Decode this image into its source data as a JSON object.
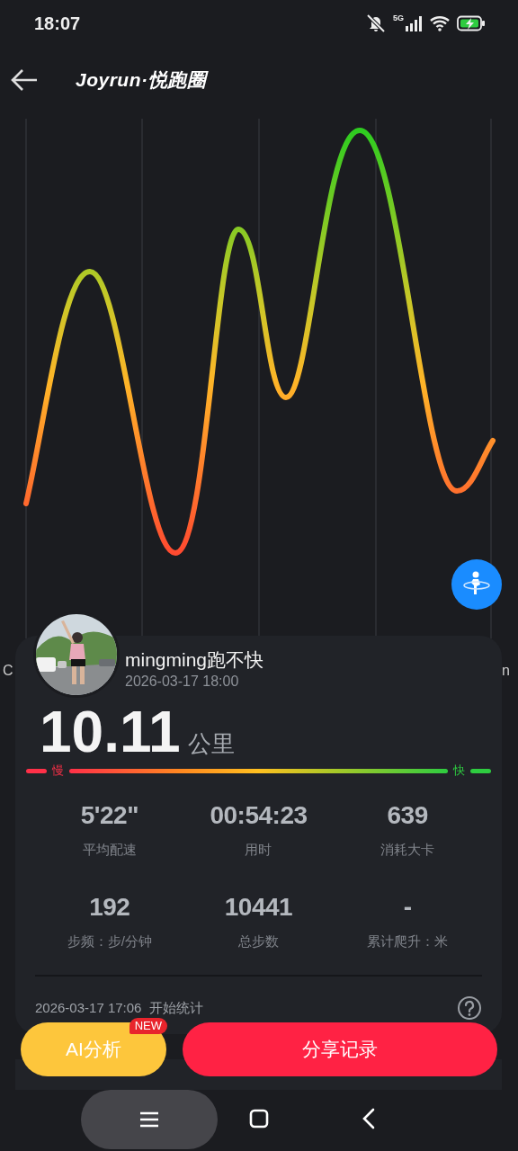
{
  "status_bar": {
    "time": "18:07",
    "network": "5G"
  },
  "header": {
    "title": "Joyrun·悦跑圈"
  },
  "chart": {
    "edge_label_left": "C",
    "edge_label_right": "n"
  },
  "run": {
    "user_name": "mingming跑不快",
    "date": "2026-03-17 18:00",
    "distance": "10.11",
    "unit": "公里",
    "slow_label": "慢",
    "fast_label": "快",
    "stats": [
      {
        "value": "5'22\"",
        "label": "平均配速"
      },
      {
        "value": "00:54:23",
        "label": "用时"
      },
      {
        "value": "639",
        "label": "消耗大卡"
      },
      {
        "value": "192",
        "label": "步频：步/分钟"
      },
      {
        "value": "10441",
        "label": "总步数"
      },
      {
        "value": "-",
        "label": "累计爬升：米"
      }
    ],
    "start_text": "2026-03-17 17:06  开始统计"
  },
  "actions": [
    {
      "label": "AI分析",
      "kind": "secondary",
      "badge": "NEW"
    },
    {
      "label": "分享记录",
      "kind": "primary"
    }
  ]
}
